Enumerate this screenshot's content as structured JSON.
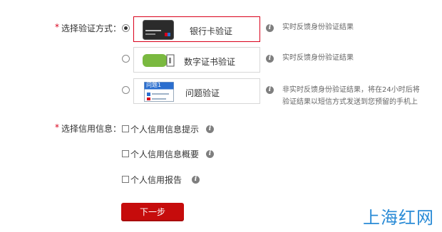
{
  "verify_section": {
    "required_mark": "*",
    "label": "选择验证方式：",
    "options": [
      {
        "label": "银行卡验证",
        "checked": true,
        "icon": "bank-card-icon",
        "hint": "实时反馈身份验证结果"
      },
      {
        "label": "数字证书验证",
        "checked": false,
        "icon": "usb-key-icon",
        "hint": "实时反馈身份验证结果"
      },
      {
        "label": "问题验证",
        "checked": false,
        "icon": "question-card-icon",
        "icon_text": "问题1",
        "hint_lines": [
          "非实时反馈身份验证结果，将在24小时后将",
          "验证结果以短信方式发送到您预留的手机上"
        ]
      }
    ]
  },
  "credit_section": {
    "required_mark": "*",
    "label": "选择信用信息：",
    "items": [
      {
        "label": "个人信用信息提示"
      },
      {
        "label": "个人信用信息概要"
      },
      {
        "label": "个人信用报告"
      }
    ]
  },
  "next_button": {
    "label": "下一步"
  },
  "watermark": {
    "text": "上海红网"
  },
  "colors": {
    "accent_red": "#c60c0c",
    "selected_border": "#d9001b",
    "watermark_blue": "#2a8bd6",
    "usb_green": "#7ab940"
  }
}
